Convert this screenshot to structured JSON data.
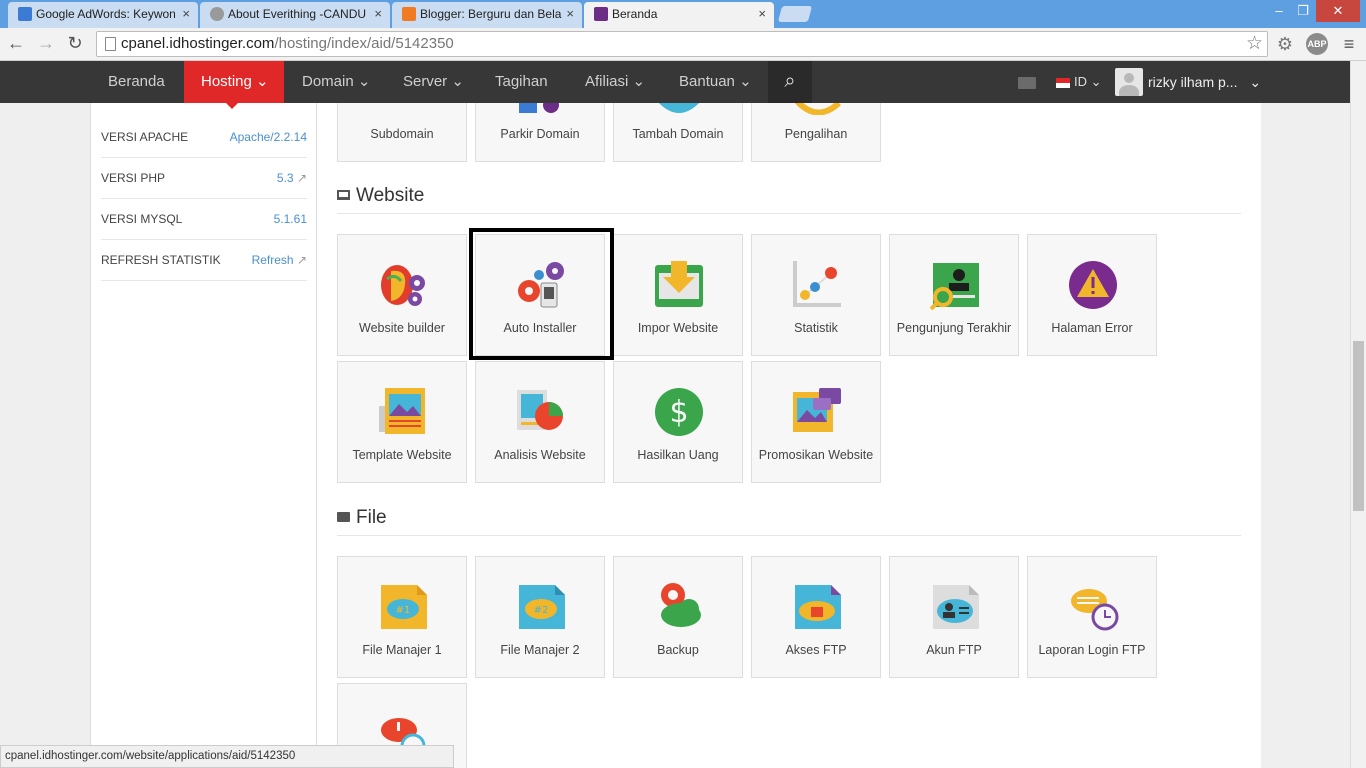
{
  "browser": {
    "tabs": [
      {
        "title": "Google AdWords: Keywon",
        "active": false
      },
      {
        "title": "About Everithing -CANDU",
        "active": false
      },
      {
        "title": "Blogger: Berguru dan Bela",
        "active": false
      },
      {
        "title": "Beranda",
        "active": true
      }
    ],
    "url_host": "cpanel.idhostinger.com",
    "url_path": "/hosting/index/aid/5142350",
    "status_url": "cpanel.idhostinger.com/website/applications/aid/5142350",
    "window_controls": {
      "minimize": "‒",
      "maximize": "❐",
      "close": "✕"
    },
    "ext_abp": "ABP"
  },
  "nav": {
    "items": [
      "Beranda",
      "Hosting",
      "Domain",
      "Server",
      "Tagihan",
      "Afiliasi",
      "Bantuan"
    ],
    "active": "Hosting",
    "lang": "ID",
    "user": "rizky ilham p...",
    "search_icon": "search-icon"
  },
  "sidebar": {
    "rows": [
      {
        "label": "VERSI APACHE",
        "value": "Apache/2.2.14"
      },
      {
        "label": "VERSI PHP",
        "value": "5.3"
      },
      {
        "label": "VERSI MYSQL",
        "value": "5.1.61"
      },
      {
        "label": "REFRESH STATISTIK",
        "value": "Refresh"
      }
    ]
  },
  "domain_tiles": [
    "Subdomain",
    "Parkir Domain",
    "Tambah Domain",
    "Pengalihan"
  ],
  "website": {
    "title": "Website",
    "tiles": [
      "Website builder",
      "Auto Installer",
      "Impor Website",
      "Statistik",
      "Pengunjung Terakhir",
      "Halaman Error",
      "Template Website",
      "Analisis Website",
      "Hasilkan Uang",
      "Promosikan Website"
    ]
  },
  "file": {
    "title": "File",
    "tiles": [
      "File Manajer 1",
      "File Manajer 2",
      "Backup",
      "Akses FTP",
      "Akun FTP",
      "Laporan Login FTP"
    ]
  },
  "colors": {
    "accent": "#e12828",
    "nav_bg": "#373737",
    "link": "#4a90d0"
  }
}
